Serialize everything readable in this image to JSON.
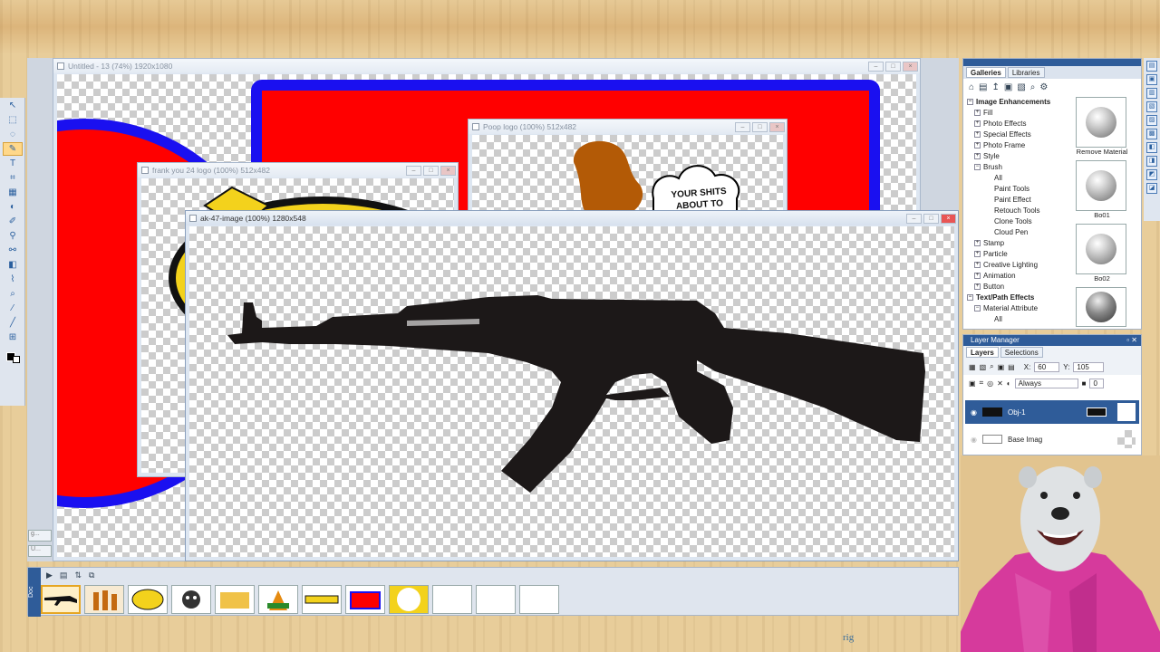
{
  "windows": {
    "untitled": {
      "title": "Untitled - 13 (74%) 1920x1080"
    },
    "poop": {
      "title": "Poop logo (100%) 512x482",
      "bubble_text": "YOUR SHITS ABOUT TO TURN"
    },
    "frank": {
      "title": "frank you 24 logo (100%) 512x482"
    },
    "ak47": {
      "title": "ak-47-image (100%) 1280x548"
    }
  },
  "galleries": {
    "tabs": [
      "Galleries",
      "Libraries"
    ],
    "tree": [
      {
        "label": "Image Enhancements",
        "level": 0,
        "state": "-"
      },
      {
        "label": "Fill",
        "level": 1,
        "state": "+"
      },
      {
        "label": "Photo Effects",
        "level": 1,
        "state": "+"
      },
      {
        "label": "Special Effects",
        "level": 1,
        "state": "+"
      },
      {
        "label": "Photo Frame",
        "level": 1,
        "state": "+"
      },
      {
        "label": "Style",
        "level": 1,
        "state": "+"
      },
      {
        "label": "Brush",
        "level": 1,
        "state": "-"
      },
      {
        "label": "All",
        "level": 2,
        "state": ""
      },
      {
        "label": "Paint Tools",
        "level": 2,
        "state": ""
      },
      {
        "label": "Paint Effect",
        "level": 2,
        "state": ""
      },
      {
        "label": "Retouch Tools",
        "level": 2,
        "state": ""
      },
      {
        "label": "Clone Tools",
        "level": 2,
        "state": ""
      },
      {
        "label": "Cloud Pen",
        "level": 2,
        "state": ""
      },
      {
        "label": "Stamp",
        "level": 1,
        "state": "+"
      },
      {
        "label": "Particle",
        "level": 1,
        "state": "+"
      },
      {
        "label": "Creative Lighting",
        "level": 1,
        "state": "+"
      },
      {
        "label": "Animation",
        "level": 1,
        "state": "+"
      },
      {
        "label": "Button",
        "level": 1,
        "state": "+"
      },
      {
        "label": "Text/Path Effects",
        "level": 0,
        "state": "-"
      },
      {
        "label": "Material Attribute",
        "level": 1,
        "state": "-"
      },
      {
        "label": "All",
        "level": 2,
        "state": ""
      }
    ],
    "thumbs": [
      "Remove Material",
      "Bo01",
      "Bo02",
      ""
    ]
  },
  "layers": {
    "header": "Layer Manager",
    "tabs": [
      "Layers",
      "Selections"
    ],
    "x_label": "X:",
    "x_value": "60",
    "y_label": "Y:",
    "y_value": "105",
    "merge_mode": "Always",
    "opacity_value": "0",
    "items": [
      {
        "name": "Obj-1",
        "selected": true
      },
      {
        "name": "Base Imag",
        "selected": false
      }
    ]
  },
  "watermark": "rig",
  "colors": {
    "accent": "#2f5c99",
    "gun": "#1c1818",
    "red": "#ff0000",
    "blue": "#1a10f0",
    "yellow": "#f3d21c"
  }
}
